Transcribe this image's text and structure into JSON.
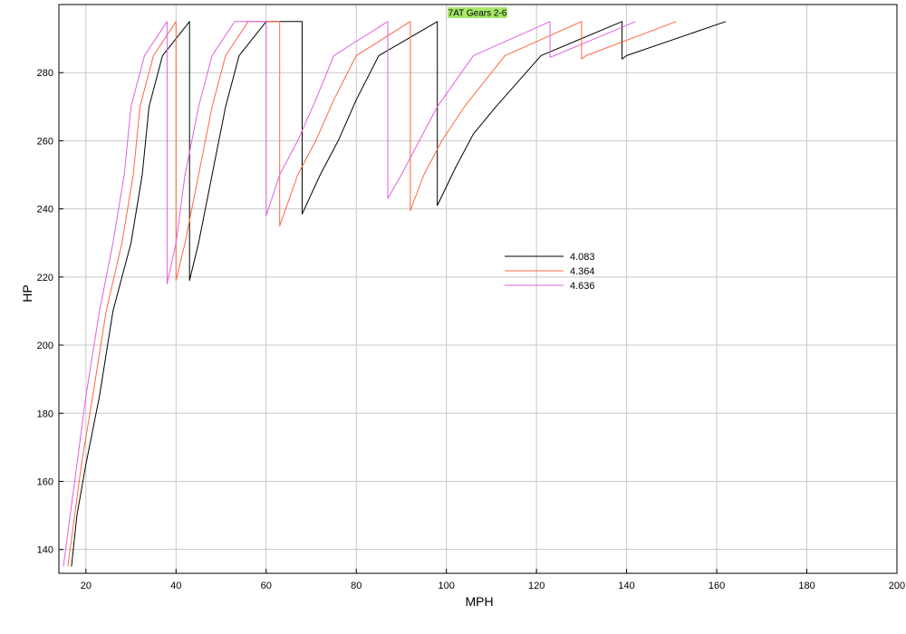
{
  "chart_data": {
    "type": "line",
    "title": "7AT Gears 2-6",
    "xlabel": "MPH",
    "ylabel": "HP",
    "xlim": [
      14,
      200
    ],
    "ylim": [
      133,
      300
    ],
    "xticks": [
      20,
      40,
      60,
      80,
      100,
      120,
      140,
      160,
      180,
      200
    ],
    "yticks": [
      140,
      160,
      180,
      200,
      220,
      240,
      260,
      280
    ],
    "grid": true,
    "legend_position": "center-right",
    "colors": {
      "title_bg": "#a6e86a",
      "grid": "#c8c8c8"
    },
    "series": [
      {
        "name": "4.083",
        "color": "#000000",
        "points": [
          [
            16.8,
            135
          ],
          [
            18,
            150
          ],
          [
            20,
            165
          ],
          [
            23,
            185
          ],
          [
            26,
            210
          ],
          [
            30,
            230
          ],
          [
            32.5,
            250
          ],
          [
            34,
            270
          ],
          [
            37,
            285
          ],
          [
            43,
            295
          ],
          [
            43,
            219
          ],
          [
            45,
            230
          ],
          [
            48,
            250
          ],
          [
            51,
            270
          ],
          [
            54,
            285
          ],
          [
            60,
            295
          ],
          [
            68,
            295
          ],
          [
            68,
            238.5
          ],
          [
            72,
            250
          ],
          [
            76,
            260
          ],
          [
            80,
            272
          ],
          [
            85,
            285
          ],
          [
            98,
            295
          ],
          [
            98,
            241
          ],
          [
            102,
            252
          ],
          [
            106,
            262
          ],
          [
            111,
            270
          ],
          [
            121,
            285
          ],
          [
            139,
            295
          ],
          [
            139,
            284
          ],
          [
            140,
            285
          ],
          [
            162,
            295
          ]
        ]
      },
      {
        "name": "4.364",
        "color": "#ff6840",
        "points": [
          [
            16,
            135
          ],
          [
            17.5,
            150
          ],
          [
            19,
            165
          ],
          [
            21.5,
            185
          ],
          [
            24.5,
            210
          ],
          [
            28,
            230
          ],
          [
            30.5,
            250
          ],
          [
            32,
            270
          ],
          [
            35,
            285
          ],
          [
            40,
            295
          ],
          [
            40,
            219
          ],
          [
            42,
            230
          ],
          [
            45,
            250
          ],
          [
            48,
            270
          ],
          [
            51,
            285
          ],
          [
            56,
            295
          ],
          [
            63,
            295
          ],
          [
            63,
            235
          ],
          [
            67,
            250
          ],
          [
            71,
            260
          ],
          [
            75,
            272
          ],
          [
            80,
            285
          ],
          [
            92,
            295
          ],
          [
            92,
            239.5
          ],
          [
            95,
            250
          ],
          [
            99,
            260
          ],
          [
            104,
            270
          ],
          [
            113,
            285
          ],
          [
            130,
            295
          ],
          [
            130,
            284
          ],
          [
            131,
            285
          ],
          [
            151,
            295
          ]
        ]
      },
      {
        "name": "4.636",
        "color": "#e060e0",
        "points": [
          [
            15,
            135
          ],
          [
            16.5,
            150
          ],
          [
            18,
            165
          ],
          [
            20,
            185
          ],
          [
            23,
            210
          ],
          [
            26,
            230
          ],
          [
            28.5,
            250
          ],
          [
            30,
            270
          ],
          [
            33,
            285
          ],
          [
            38,
            295
          ],
          [
            38,
            218
          ],
          [
            40,
            230
          ],
          [
            42,
            250
          ],
          [
            45,
            270
          ],
          [
            48,
            285
          ],
          [
            53,
            295
          ],
          [
            60,
            295
          ],
          [
            60,
            238
          ],
          [
            63,
            250
          ],
          [
            67,
            260
          ],
          [
            71,
            272
          ],
          [
            75,
            285
          ],
          [
            87,
            295
          ],
          [
            87,
            243
          ],
          [
            90,
            250
          ],
          [
            94,
            260
          ],
          [
            98,
            270
          ],
          [
            106,
            285
          ],
          [
            123,
            295
          ],
          [
            123,
            284.5
          ],
          [
            124,
            285
          ],
          [
            142,
            295
          ]
        ]
      }
    ]
  }
}
